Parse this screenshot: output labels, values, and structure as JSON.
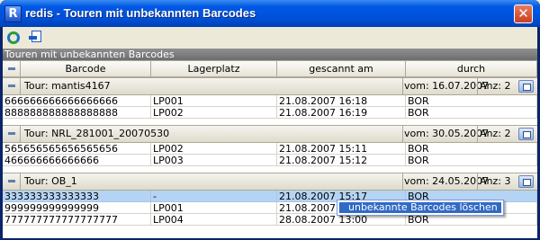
{
  "window": {
    "title": "redis - Touren mit unbekannten Barcodes",
    "app_icon": "R",
    "close_symbol": "✕"
  },
  "toolbar": {
    "buttons": [
      {
        "icon": "refresh-icon"
      },
      {
        "icon": "export-icon"
      }
    ]
  },
  "panel": {
    "title": "Touren mit unbekannten Barcodes"
  },
  "table": {
    "columns": [
      "Barcode",
      "Lagerplatz",
      "gescannt am",
      "durch"
    ],
    "groups": [
      {
        "title": "Tour: mantis4167",
        "vom": "vom: 16.07.2007",
        "anz": "Anz: 2",
        "rows": [
          {
            "barcode": "666666666666666666",
            "lagerplatz": "LP001",
            "gescannt": "21.08.2007 16:18",
            "durch": "BOR"
          },
          {
            "barcode": "888888888888888888",
            "lagerplatz": "LP002",
            "gescannt": "21.08.2007 16:19",
            "durch": "BOR"
          }
        ]
      },
      {
        "title": "Tour: NRL_281001_20070530",
        "vom": "vom: 30.05.2007",
        "anz": "Anz: 2",
        "rows": [
          {
            "barcode": "565656565656565656",
            "lagerplatz": "LP002",
            "gescannt": "21.08.2007 15:11",
            "durch": "BOR"
          },
          {
            "barcode": "466666666666666",
            "lagerplatz": "LP003",
            "gescannt": "21.08.2007 15:12",
            "durch": "BOR"
          }
        ]
      },
      {
        "title": "Tour: OB_1",
        "vom": "vom: 24.05.2007",
        "anz": "Anz: 3",
        "rows": [
          {
            "barcode": "333333333333333",
            "lagerplatz": "-",
            "gescannt": "21.08.2007 15:17",
            "durch": "BOR",
            "selected": true
          },
          {
            "barcode": "999999999999999",
            "lagerplatz": "LP001",
            "gescannt": "21.08.2007 1",
            "durch": "BOR"
          },
          {
            "barcode": "777777777777777777",
            "lagerplatz": "LP004",
            "gescannt": "28.08.2007 13:00",
            "durch": "BOR"
          }
        ]
      }
    ]
  },
  "context_menu": {
    "items": [
      "unbekannte Barcodes löschen"
    ]
  }
}
